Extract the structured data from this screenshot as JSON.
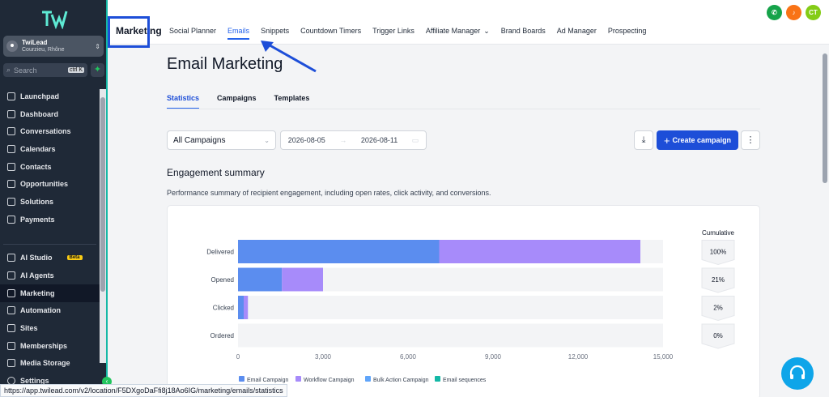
{
  "sidebar": {
    "account": {
      "name": "TwiLead",
      "location": "Courzieu, Rhône"
    },
    "search": {
      "placeholder": "Search",
      "shortcut": "ctrl K"
    },
    "items": [
      {
        "label": "Launchpad",
        "icon": "rocket-icon"
      },
      {
        "label": "Dashboard",
        "icon": "grid-icon"
      },
      {
        "label": "Conversations",
        "icon": "chat-icon"
      },
      {
        "label": "Calendars",
        "icon": "calendar-icon"
      },
      {
        "label": "Contacts",
        "icon": "contacts-icon"
      },
      {
        "label": "Opportunities",
        "icon": "funnel-icon"
      },
      {
        "label": "Solutions",
        "icon": "bulb-icon"
      },
      {
        "label": "Payments",
        "icon": "receipt-icon"
      }
    ],
    "items2": [
      {
        "label": "AI Studio",
        "icon": "sparkle-icon",
        "badge": "Beta"
      },
      {
        "label": "AI Agents",
        "icon": "bot-icon"
      },
      {
        "label": "Marketing",
        "icon": "send-icon",
        "active": true
      },
      {
        "label": "Automation",
        "icon": "automation-icon"
      },
      {
        "label": "Sites",
        "icon": "globe-icon"
      },
      {
        "label": "Memberships",
        "icon": "member-icon"
      },
      {
        "label": "Media Storage",
        "icon": "image-icon"
      }
    ],
    "settings": "Settings"
  },
  "topbar": {
    "section": "Marketing",
    "nav": [
      "Social Planner",
      "Emails",
      "Snippets",
      "Countdown Timers",
      "Trigger Links",
      "Affiliate Manager",
      "Brand Boards",
      "Ad Manager",
      "Prospecting"
    ],
    "active": "Emails",
    "avatar": "CT",
    "colors": {
      "phone": "#16a34a",
      "bell": "#f97316",
      "avatar": "#84cc16"
    }
  },
  "main": {
    "title": "Email Marketing",
    "tabs": [
      "Statistics",
      "Campaigns",
      "Templates"
    ],
    "active_tab": "Statistics",
    "filter": "All Campaigns",
    "date_from": "2026-08-05",
    "date_to": "2026-08-11",
    "create_label": "Create campaign",
    "engagement_title": "Engagement summary",
    "engagement_desc": "Performance summary of recipient engagement, including open rates, click activity, and conversions."
  },
  "chart_data": {
    "type": "bar",
    "orientation": "horizontal",
    "stacked": true,
    "categories": [
      "Delivered",
      "Opened",
      "Clicked",
      "Ordered"
    ],
    "series": [
      {
        "name": "Email Campaign",
        "color": "#5b8def",
        "values": [
          7100,
          1550,
          200,
          0
        ]
      },
      {
        "name": "Workflow Campaign",
        "color": "#a78bfa",
        "values": [
          7100,
          1450,
          150,
          0
        ]
      },
      {
        "name": "Bulk Action Campaign",
        "color": "#60a5fa",
        "values": [
          0,
          0,
          0,
          0
        ]
      },
      {
        "name": "Email sequences",
        "color": "#14b8a6",
        "values": [
          0,
          0,
          0,
          0
        ]
      }
    ],
    "xlim": [
      0,
      15000
    ],
    "xticks": [
      "0",
      "3,000",
      "6,000",
      "9,000",
      "12,000",
      "15,000"
    ],
    "cumulative_title": "Cumulative",
    "cumulative": [
      "100%",
      "21%",
      "2%",
      "0%"
    ],
    "legend_position": "bottom"
  },
  "statusbar": {
    "url": "https://app.twilead.com/v2/location/F5DXgoDaFfi8j18Ao6IG/marketing/emails/statistics"
  }
}
